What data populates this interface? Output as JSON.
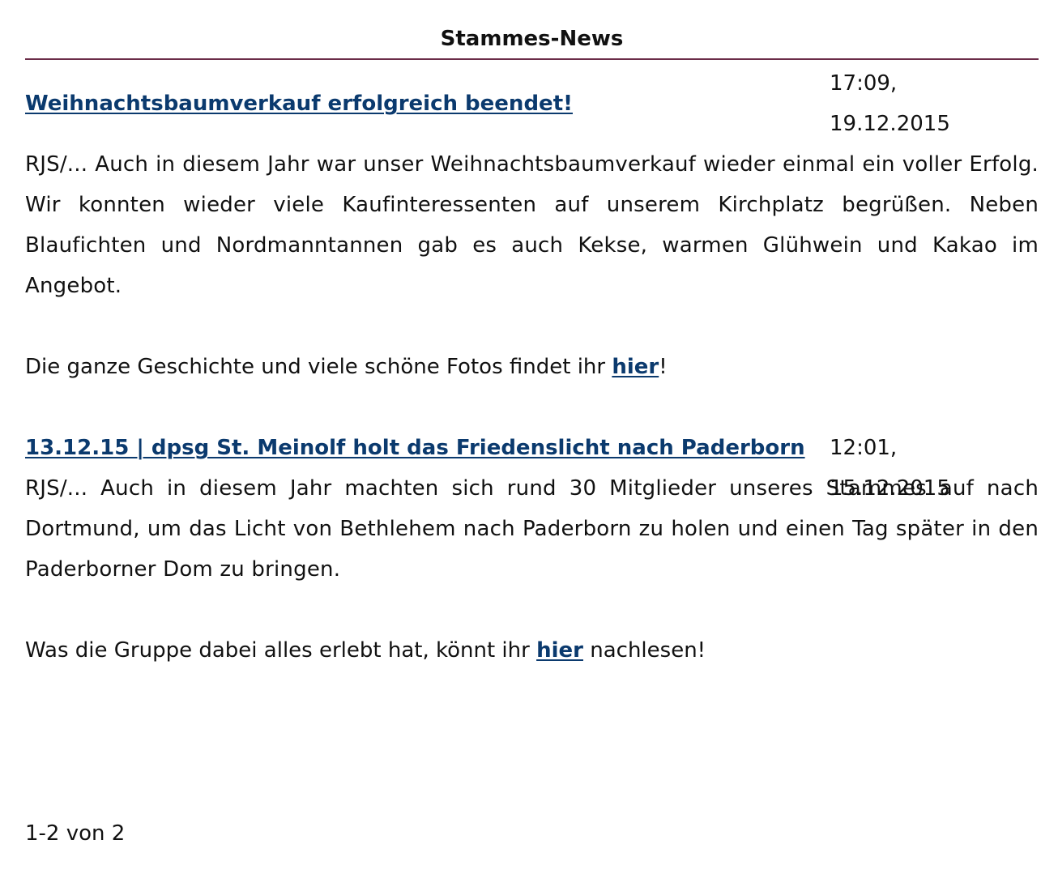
{
  "page": {
    "heading": "Stammes-News"
  },
  "news": [
    {
      "title": "Weihnachtsbaumverkauf erfolgreich beendet!",
      "time": "17:09,",
      "date": "19.12.2015",
      "body": "RJS/... Auch in diesem Jahr war unser Weihnachtsbaumverkauf wieder einmal ein voller Erfolg. Wir konnten wieder viele Kaufinteressenten auf unserem Kirchplatz begrüßen. Neben Blaufichten und Nordmanntannen gab es auch Kekse, warmen Glühwein und Kakao im Angebot.",
      "more_before": "Die ganze Geschichte und viele schöne Fotos findet ihr ",
      "more_link": "hier",
      "more_after": "!"
    },
    {
      "title": "13.12.15 | dpsg St. Meinolf holt das Friedenslicht nach Paderborn",
      "time": "12:01,",
      "date": "15.12.2015",
      "body": "RJS/... Auch in diesem Jahr machten sich rund 30 Mitglieder unseres Stammes auf nach Dortmund, um das Licht von Bethlehem nach Paderborn zu holen und einen Tag später in den Paderborner Dom zu bringen.",
      "more_before": "Was die Gruppe dabei alles erlebt hat, könnt ihr ",
      "more_link": "hier",
      "more_after": " nachlesen!"
    }
  ],
  "pagination": {
    "label": "1-2 von 2"
  },
  "colors": {
    "link": "#0b3a6e",
    "rule": "#6b2c48",
    "text": "#111111"
  }
}
